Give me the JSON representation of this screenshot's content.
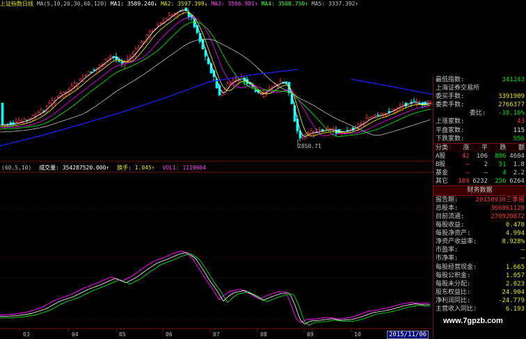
{
  "ma_bar": {
    "prefix": "上证指数日线",
    "params": "MA(5,10,20,30,60,120)",
    "ma1": "MA1: 3589.240↓",
    "ma2": "MA2: 3597.399↓",
    "ma3": "MA3: 3566.981↑",
    "ma4": "MA4: 3508.750↑",
    "ma5": "MA5: 3337.392↑"
  },
  "low_annotation": "2850.71",
  "volume_bar": {
    "prefix": "(60,5,10)",
    "vol": "成交量: 354287520.000↑",
    "turn": "换手: 1.045↑",
    "vol1": "VOL1: 1119604"
  },
  "x_axis": {
    "ticks": [
      "03",
      "04",
      "05",
      "06",
      "07",
      "08",
      "09",
      "10"
    ],
    "current_date": "2015/11/06"
  },
  "watermark": "www.7gpzb.com",
  "quote_panel": {
    "rows": [
      {
        "label": "最低指数:",
        "value": "341243",
        "color": "#00e000"
      },
      {
        "label": "上海证券交易所",
        "value": "",
        "color": "#c8c8c8"
      },
      {
        "label": "委买手数:",
        "value": "3391909",
        "color": "#e6e600"
      },
      {
        "label": "委卖手数:",
        "value": "2766377",
        "color": "#e6e600"
      },
      {
        "label": "委比:",
        "value": "-10.16%",
        "color": "#00e000",
        "indent": true
      },
      {
        "label": "上涨家数:",
        "value": "43",
        "color": "#ff3c3c"
      },
      {
        "label": "平盘家数:",
        "value": "115",
        "color": "#e0e0e0"
      },
      {
        "label": "下跌家数:",
        "value": "956",
        "color": "#00e000"
      }
    ],
    "table_header": [
      "分类",
      "涨",
      "平",
      "跌",
      "额(亿)"
    ],
    "table_rows": [
      [
        "A股",
        "42",
        "106",
        "886",
        "4604"
      ],
      [
        "B股",
        "–",
        "2",
        "51",
        "1.8"
      ],
      [
        "基金",
        "–",
        "–",
        "4",
        "2.2"
      ],
      [
        "其它",
        "104",
        "6232",
        "256",
        "6264"
      ]
    ],
    "finance_title": "财务数据",
    "finance_rows": [
      {
        "label": "报告期:",
        "value": "20150930三季报"
      },
      {
        "label": "总股本:",
        "value": "366961120"
      },
      {
        "label": "目前流通:",
        "value": "270920872"
      },
      {
        "label": "每股收益:",
        "value": "0.470"
      },
      {
        "label": "每股净资产:",
        "value": "4.994"
      },
      {
        "label": "净资产收益率:",
        "value": "8.928%"
      },
      {
        "label": "市盈率:",
        "value": "–"
      },
      {
        "label": "市净率:",
        "value": "–"
      },
      {
        "label": "每股经营现金:",
        "value": "1.665"
      },
      {
        "label": "每股公积金:",
        "value": "1.057"
      },
      {
        "label": "每股未分配:",
        "value": "2.023"
      },
      {
        "label": "股东权益比:",
        "value": "24.904"
      },
      {
        "label": "净利润同比:",
        "value": "-24.779"
      },
      {
        "label": "主营收入同比:",
        "value": "6.193"
      }
    ]
  },
  "colors": {
    "up": "#ff3c3c",
    "down": "#00ffff",
    "ma5": "#ffffff",
    "ma10": "#ffff00",
    "ma20": "#ff00ff",
    "ma30": "#00ff00",
    "ma60": "#c0c0c0",
    "ma120": "#2020ff"
  }
}
